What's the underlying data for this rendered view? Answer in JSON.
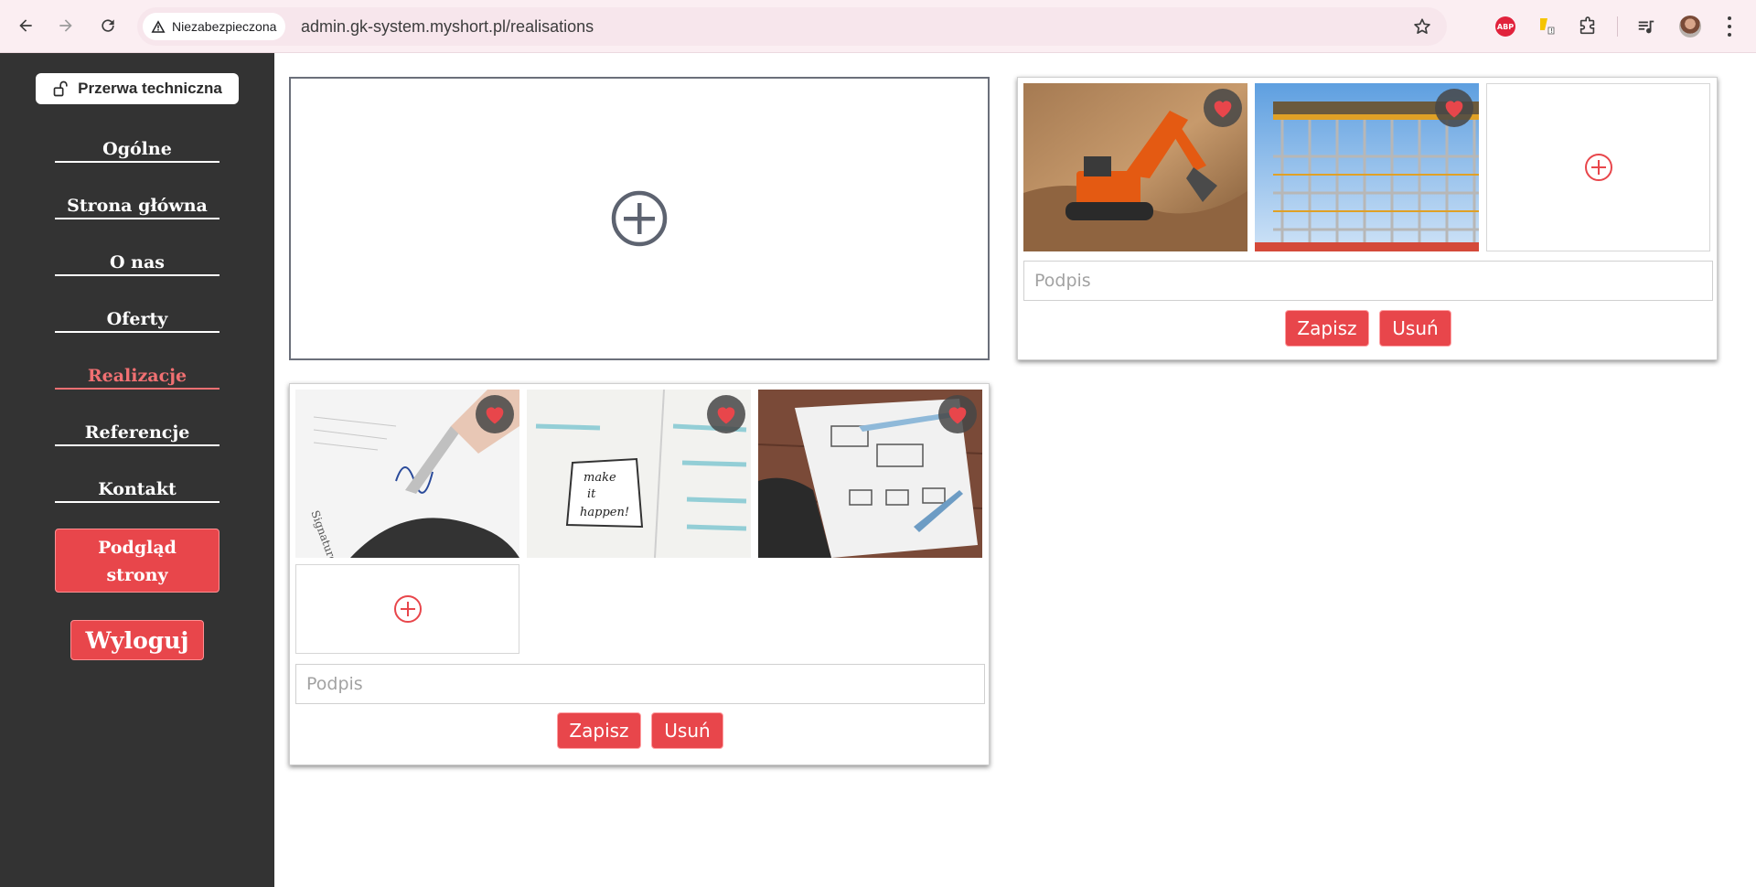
{
  "browser": {
    "security_label": "Niezabezpieczona",
    "url": "admin.gk-system.myshort.pl/realisations",
    "icons": [
      "back-icon",
      "forward-icon",
      "reload-icon",
      "warning-icon",
      "star-icon",
      "adblock-icon",
      "extension-icon",
      "puzzle-icon",
      "media-icon",
      "profile-icon",
      "menu-icon"
    ],
    "abp_label": "ABP"
  },
  "sidebar": {
    "maintenance_label": "Przerwa techniczna",
    "items": [
      {
        "label": "Ogólne",
        "active": false
      },
      {
        "label": "Strona główna",
        "active": false
      },
      {
        "label": "O nas",
        "active": false
      },
      {
        "label": "Oferty",
        "active": false
      },
      {
        "label": "Realizacje",
        "active": true
      },
      {
        "label": "Referencje",
        "active": false
      },
      {
        "label": "Kontakt",
        "active": false
      }
    ],
    "preview_line1": "Podgląd",
    "preview_line2": "strony",
    "logout_label": "Wyloguj"
  },
  "colors": {
    "sidebar_bg": "#333333",
    "accent": "#e8464b",
    "active_link": "#f07072"
  },
  "realisations": [
    {
      "photos": [
        "excavator-photo",
        "scaffolding-photo"
      ],
      "caption_placeholder": "Podpis",
      "caption_value": "",
      "save_label": "Zapisz",
      "delete_label": "Usuń"
    },
    {
      "photos": [
        "signature-photo",
        "notebook-photo",
        "wireframe-photo"
      ],
      "caption_placeholder": "Podpis",
      "caption_value": "",
      "save_label": "Zapisz",
      "delete_label": "Usuń"
    }
  ]
}
